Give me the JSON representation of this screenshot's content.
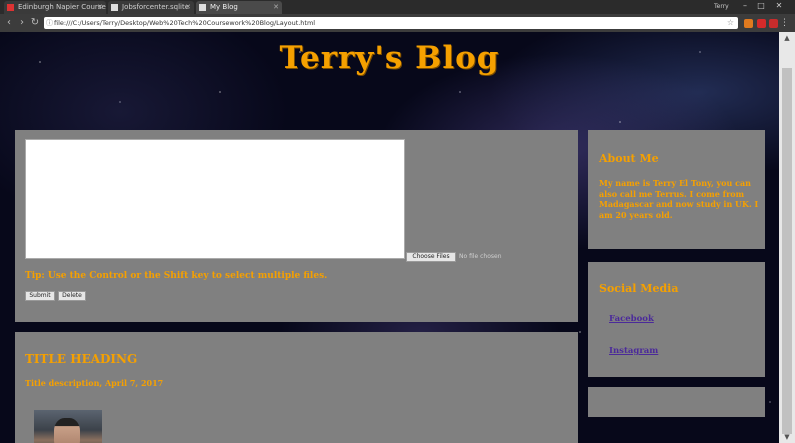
{
  "browser": {
    "tabs": [
      {
        "label": "Edinburgh Napier Courses"
      },
      {
        "label": "Jobsforcenter.sqlite"
      },
      {
        "label": "My Blog"
      }
    ],
    "profile": "Terry",
    "url": "file:///C:/Users/Terry/Desktop/Web%20Tech%20Coursework%20Blog/Layout.html"
  },
  "blog": {
    "title": "Terry's Blog"
  },
  "upload": {
    "choose_label": "Choose Files",
    "no_file_text": "No file chosen",
    "tip": "Tip: Use the Control or the Shift key to select multiple files.",
    "submit_label": "Submit",
    "delete_label": "Delete"
  },
  "post": {
    "heading": "TITLE HEADING",
    "meta": "Title description, April 7, 2017"
  },
  "about": {
    "heading": "About Me",
    "text": "My name is Terry El Tony, you can also call me Terrus. I come from Madagascar and now study in UK. I am 20 years old."
  },
  "social": {
    "heading": "Social Media",
    "links": [
      {
        "label": "Facebook"
      },
      {
        "label": "Instagram"
      }
    ]
  },
  "colors": {
    "accent": "#f5a000",
    "card": "#808080",
    "link": "#4b2a9a"
  }
}
